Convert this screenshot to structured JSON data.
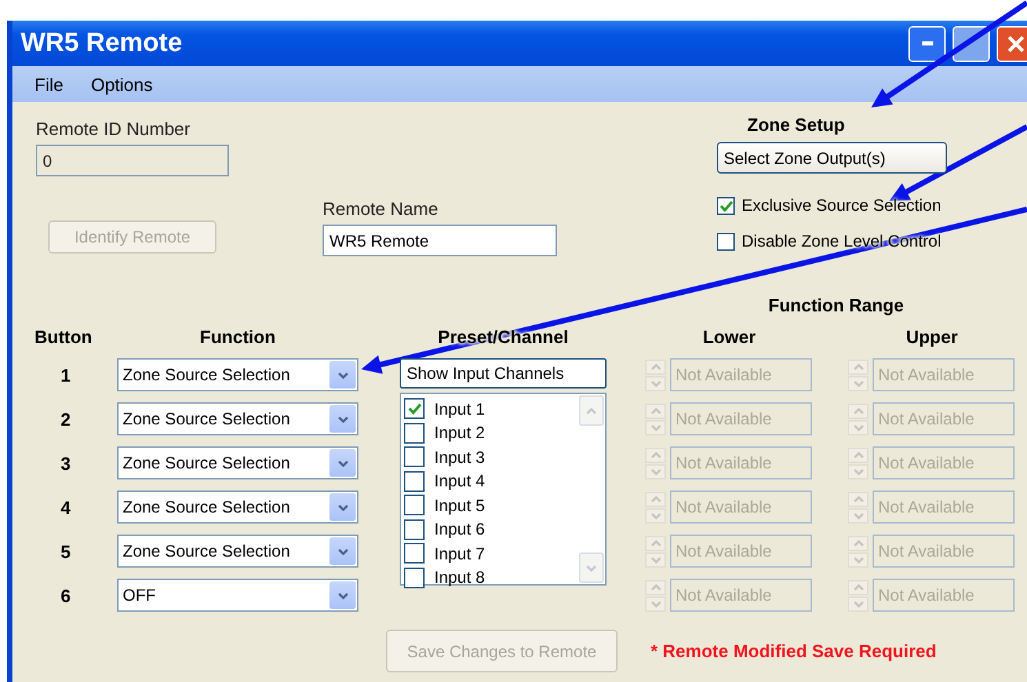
{
  "window": {
    "title": "WR5 Remote"
  },
  "menu": [
    "File",
    "Options"
  ],
  "remote_id": {
    "label": "Remote ID Number",
    "value": "0",
    "disabled": true
  },
  "identify_button": {
    "label": "Identify Remote",
    "disabled": true
  },
  "remote_name": {
    "label": "Remote Name",
    "value": "WR5 Remote"
  },
  "zone_setup": {
    "title": "Zone Setup",
    "button": "Select Zone Output(s)",
    "options": [
      {
        "label": "Exclusive Source Selection",
        "checked": true
      },
      {
        "label": "Disable Zone Level Control",
        "checked": false
      }
    ]
  },
  "table": {
    "range_title": "Function Range",
    "columns": [
      "Button",
      "Function",
      "Preset/Channel",
      "Lower",
      "Upper"
    ],
    "rows": [
      {
        "button": "1",
        "function": "Zone Source Selection",
        "lower": {
          "value": "Not Available",
          "disabled": true
        },
        "upper": {
          "value": "Not Available",
          "disabled": true
        }
      },
      {
        "button": "2",
        "function": "Zone Source Selection",
        "lower": {
          "value": "Not Available",
          "disabled": true
        },
        "upper": {
          "value": "Not Available",
          "disabled": true
        }
      },
      {
        "button": "3",
        "function": "Zone Source Selection",
        "lower": {
          "value": "Not Available",
          "disabled": true
        },
        "upper": {
          "value": "Not Available",
          "disabled": true
        }
      },
      {
        "button": "4",
        "function": "Zone Source Selection",
        "lower": {
          "value": "Not Available",
          "disabled": true
        },
        "upper": {
          "value": "Not Available",
          "disabled": true
        }
      },
      {
        "button": "5",
        "function": "Zone Source Selection",
        "lower": {
          "value": "Not Available",
          "disabled": true
        },
        "upper": {
          "value": "Not Available",
          "disabled": true
        }
      },
      {
        "button": "6",
        "function": "OFF",
        "lower": {
          "value": "Not Available",
          "disabled": true
        },
        "upper": {
          "value": "Not Available",
          "disabled": true
        }
      }
    ]
  },
  "preset": {
    "button": "Show Input Channels",
    "channels": [
      {
        "label": "Input 1",
        "checked": true
      },
      {
        "label": "Input 2",
        "checked": false
      },
      {
        "label": "Input 3",
        "checked": false
      },
      {
        "label": "Input 4",
        "checked": false
      },
      {
        "label": "Input 5",
        "checked": false
      },
      {
        "label": "Input 6",
        "checked": false
      },
      {
        "label": "Input 7",
        "checked": false
      },
      {
        "label": "Input 8",
        "checked": false
      }
    ]
  },
  "save_button": {
    "label": "Save Changes to Remote",
    "disabled": true
  },
  "status": "* Remote Modified Save Required"
}
